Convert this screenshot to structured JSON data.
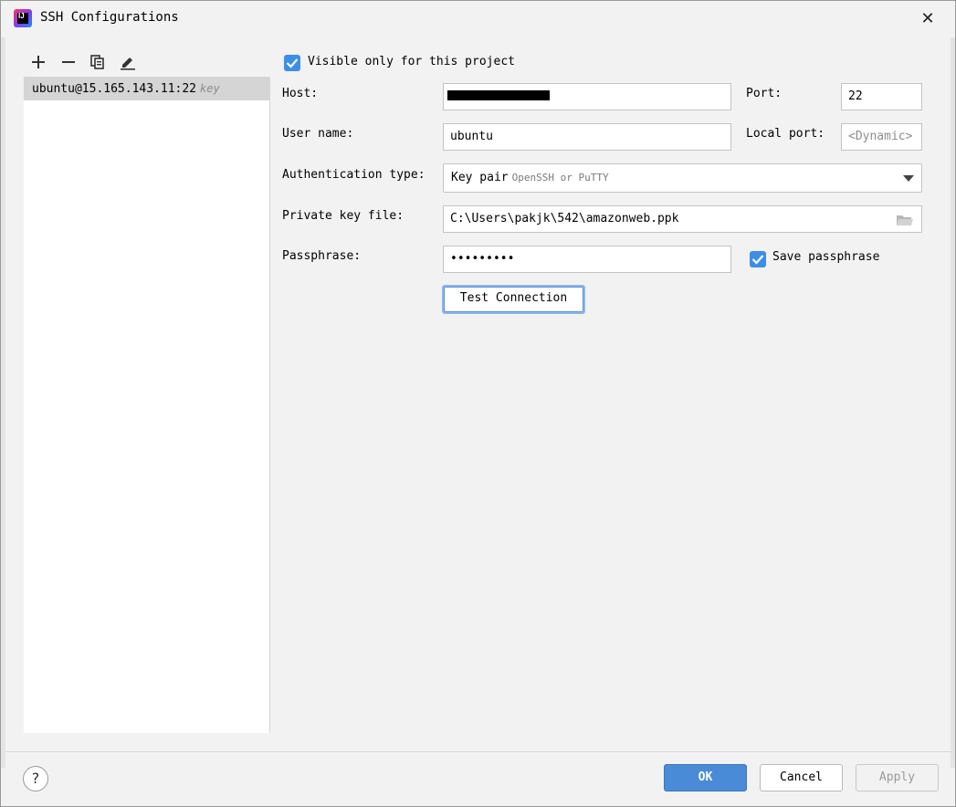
{
  "window": {
    "title": "SSH Configurations",
    "close_glyph": "✕"
  },
  "toolbar": {
    "add_icon": "plus-icon",
    "remove_icon": "minus-icon",
    "copy_icon": "copy-icon",
    "edit_icon": "pencil-icon"
  },
  "config_list": {
    "items": [
      {
        "label": "ubuntu@15.165.143.11:22",
        "hint": "key"
      }
    ]
  },
  "form": {
    "visible_only_label": "Visible only for this project",
    "visible_only_checked": true,
    "host_label": "Host:",
    "host_value": "",
    "port_label": "Port:",
    "port_value": "22",
    "username_label": "User name:",
    "username_value": "ubuntu",
    "local_port_label": "Local port:",
    "local_port_placeholder": "<Dynamic>",
    "auth_type_label": "Authentication type:",
    "auth_type_value": "Key pair",
    "auth_type_sub": "OpenSSH or PuTTY",
    "private_key_label": "Private key file:",
    "private_key_value": "C:\\Users\\pakjk\\542\\amazonweb.ppk",
    "passphrase_label": "Passphrase:",
    "passphrase_value": "•••••••••",
    "save_passphrase_label": "Save passphrase",
    "save_passphrase_checked": true,
    "test_connection_label": "Test Connection"
  },
  "footer": {
    "help_label": "?",
    "ok_label": "OK",
    "cancel_label": "Cancel",
    "apply_label": "Apply"
  },
  "colors": {
    "accent": "#3d8ee8",
    "primary_button": "#4a8bd7",
    "selection": "#d5d5d5"
  }
}
